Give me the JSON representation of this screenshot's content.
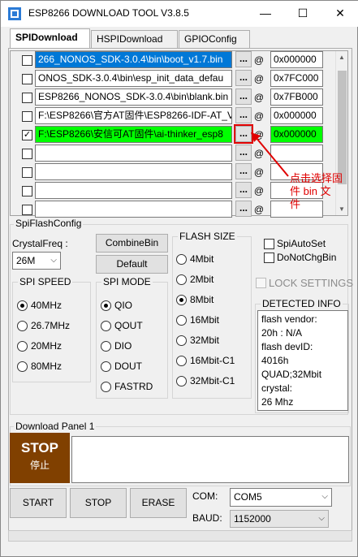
{
  "window": {
    "title": "ESP8266 DOWNLOAD TOOL V3.8.5",
    "controls": [
      "—",
      "☐",
      "✕"
    ]
  },
  "tabs": [
    {
      "label": "SPIDownload",
      "active": true
    },
    {
      "label": "HSPIDownload",
      "active": false
    },
    {
      "label": "GPIOConfig",
      "active": false
    }
  ],
  "files": [
    {
      "checked": false,
      "path": "266_NONOS_SDK-3.0.4\\bin\\boot_v1.7.bin",
      "style": "selected",
      "button": "...",
      "at": "@",
      "address": "0x000000",
      "addr_style": "normal"
    },
    {
      "checked": false,
      "path": "ONOS_SDK-3.0.4\\bin\\esp_init_data_defau",
      "style": "normal",
      "button": "...",
      "at": "@",
      "address": "0x7FC000",
      "addr_style": "normal"
    },
    {
      "checked": false,
      "path": "ESP8266_NONOS_SDK-3.0.4\\bin\\blank.bin",
      "style": "normal",
      "button": "...",
      "at": "@",
      "address": "0x7FB000",
      "addr_style": "normal"
    },
    {
      "checked": false,
      "path": "F:\\ESP8266\\官方AT固件\\ESP8266-IDF-AT_V",
      "style": "normal",
      "button": "...",
      "at": "@",
      "address": "0x000000",
      "addr_style": "normal"
    },
    {
      "checked": true,
      "path": "F:\\ESP8266\\安信可AT固件\\ai-thinker_esp8",
      "style": "green",
      "button": "...",
      "at": "@",
      "address": "0x000000",
      "addr_style": "green"
    },
    {
      "checked": false,
      "path": "",
      "style": "normal",
      "button": "...",
      "at": "@",
      "address": "",
      "addr_style": "normal"
    },
    {
      "checked": false,
      "path": "",
      "style": "normal",
      "button": "...",
      "at": "@",
      "address": "",
      "addr_style": "normal"
    },
    {
      "checked": false,
      "path": "",
      "style": "normal",
      "button": "...",
      "at": "@",
      "address": "",
      "addr_style": "normal"
    },
    {
      "checked": false,
      "path": "",
      "style": "normal",
      "button": "...",
      "at": "@",
      "address": "",
      "addr_style": "normal"
    }
  ],
  "annotation": {
    "line1": "点击选择固",
    "line2": "件 bin 文",
    "line3": "件",
    "color": "#e00000"
  },
  "spi_flash_config": {
    "title": "SpiFlashConfig",
    "crystal_label": "CrystalFreq :",
    "crystal_value": "26M",
    "combine_label": "CombineBin",
    "default_label": "Default",
    "spi_speed": {
      "title": "SPI SPEED",
      "options": [
        {
          "label": "40MHz",
          "selected": true
        },
        {
          "label": "26.7MHz",
          "selected": false
        },
        {
          "label": "20MHz",
          "selected": false
        },
        {
          "label": "80MHz",
          "selected": false
        }
      ]
    },
    "spi_mode": {
      "title": "SPI MODE",
      "options": [
        {
          "label": "QIO",
          "selected": true
        },
        {
          "label": "QOUT",
          "selected": false
        },
        {
          "label": "DIO",
          "selected": false
        },
        {
          "label": "DOUT",
          "selected": false
        },
        {
          "label": "FASTRD",
          "selected": false
        }
      ]
    },
    "flash_size": {
      "title": "FLASH SIZE",
      "options": [
        {
          "label": "4Mbit",
          "selected": false
        },
        {
          "label": "2Mbit",
          "selected": false
        },
        {
          "label": "8Mbit",
          "selected": true
        },
        {
          "label": "16Mbit",
          "selected": false
        },
        {
          "label": "32Mbit",
          "selected": false
        },
        {
          "label": "16Mbit-C1",
          "selected": false
        },
        {
          "label": "32Mbit-C1",
          "selected": false
        }
      ]
    },
    "spi_auto_set": {
      "label": "SpiAutoSet",
      "checked": false
    },
    "do_not_chg_bin": {
      "label": "DoNotChgBin",
      "checked": false
    },
    "lock_settings": {
      "label": "LOCK SETTINGS",
      "checked": false
    },
    "detected_info": {
      "title": "DETECTED INFO",
      "lines": [
        "flash vendor:",
        "20h : N/A",
        "flash devID:",
        "4016h",
        "QUAD;32Mbit",
        "crystal:",
        "26 Mhz"
      ]
    }
  },
  "download_panel": {
    "title": "Download Panel 1",
    "stop_tile": {
      "title": "STOP",
      "subtitle": "停止",
      "color": "#804000"
    },
    "log": ""
  },
  "actions": {
    "start": "START",
    "stop": "STOP",
    "erase": "ERASE",
    "com_label": "COM:",
    "com_value": "COM5",
    "baud_label": "BAUD:",
    "baud_value": "1152000"
  }
}
